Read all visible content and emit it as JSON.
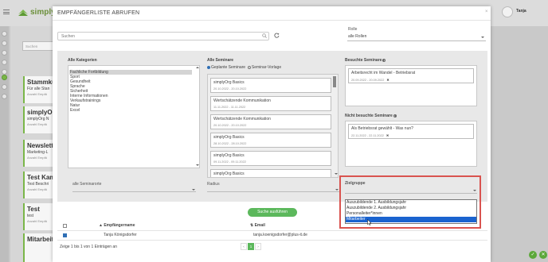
{
  "app": {
    "logo_text": "simplyOr",
    "user_name": "Tanja"
  },
  "sidebar": {
    "search_placeholder": "Suchen",
    "cards": [
      {
        "title": "Stammku",
        "subtitle": "Für alle Stan",
        "meta": "Anzahl Empfä"
      },
      {
        "title": "simplyOr",
        "subtitle": "simplyOrg N",
        "meta": "Anzahl Empfä"
      },
      {
        "title": "Newslett",
        "subtitle": "Marketing-L",
        "meta": "Anzahl Empfä"
      },
      {
        "title": "Test Kam",
        "subtitle": "Test Beschri",
        "meta": "Anzahl Empfä"
      },
      {
        "title": "Test",
        "subtitle": "test",
        "meta": "Anzahl Empfä"
      },
      {
        "title": "Mitarbeit",
        "subtitle": "",
        "meta": ""
      }
    ]
  },
  "modal": {
    "title": "EMPFÄNGERLISTE ABRUFEN",
    "close_icon": "×",
    "search_placeholder": "Suchen",
    "role_label": "Rolle",
    "role_value": "alle Rollen",
    "categories": {
      "heading": "Alle Kategorien",
      "items": [
        "Fachliche Fortbildung",
        "Sport",
        "Gesundheit",
        "Sprache",
        "Sicherheit",
        "Interne Informationen",
        "Verkaufstrainings",
        "Natur",
        "Excel"
      ],
      "selected_index": 0
    },
    "seminars": {
      "heading": "Alle Seminare",
      "radio_planned": "Geplante Seminare",
      "radio_template": "Seminar-Vorlage",
      "items": [
        {
          "name": "simplyOrg Basics",
          "date": "20.10.2022 - 20.10.2022"
        },
        {
          "name": "Wertschätzende Kommunikation",
          "date": "11.11.2022 - 11.11.2022"
        },
        {
          "name": "Wertschätzende Kommunikation",
          "date": "20.10.2022 - 20.10.2022"
        },
        {
          "name": "simplyOrg Basics",
          "date": "28.10.2022 - 28.10.2022"
        },
        {
          "name": "simplyOrg Basics",
          "date": "09.11.2022 - 09.11.2022"
        },
        {
          "name": "simplyOrg Basics",
          "date": ""
        }
      ]
    },
    "visited": {
      "heading": "Besuchte Seminare",
      "items": [
        {
          "name": "Arbeitsrecht im Wandel - Betriebsrat",
          "date": "20.09.2022 - 20.09.2022"
        }
      ]
    },
    "not_visited": {
      "heading": "Nicht besuchte Seminare",
      "items": [
        {
          "name": "Als Betriebsrat gewählt - Was nun?",
          "date": "22.11.2022 - 22.11.2022"
        }
      ]
    },
    "field_all_seminars": "alle Seminarorte",
    "field_radius": "Radius",
    "zielgruppe": {
      "label": "Zielgruppe",
      "options": [
        "Auszubildende 1. Ausbildungsjahr",
        "Auszubildende 2. Ausbildungsjahr",
        "Personalleiter*innen",
        "Mitarbeiter"
      ],
      "selected_index": 3
    },
    "submit_label": "Suche ausführen",
    "table": {
      "columns": [
        "Empfängername",
        "Email"
      ],
      "rows": [
        {
          "name": "Tanja Königsdorfer",
          "email": "tanja.koenigsdorfer@plus-it.de",
          "checked": true
        }
      ]
    },
    "footer_text": "Zeige 1 bis 1 von 1 Einträgen an",
    "pagination": {
      "prev": "‹",
      "current": "1",
      "next": "›"
    }
  },
  "bottom_buttons": {
    "confirm": "✓",
    "cancel": "✕"
  }
}
